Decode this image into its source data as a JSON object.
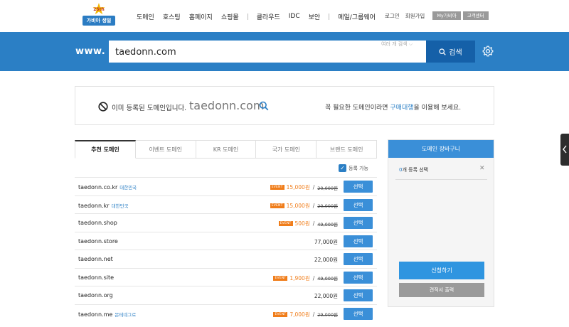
{
  "header": {
    "logo_badge": "25th",
    "logo_text": "가비아 생일",
    "nav": [
      "도메인",
      "호스팅",
      "홈페이지",
      "쇼핑몰",
      "클라우드",
      "IDC",
      "보안",
      "메일/그룹웨어"
    ],
    "util": {
      "login": "로그인",
      "signup": "회원가입",
      "my": "My가비아",
      "support": "고객센터"
    }
  },
  "search": {
    "prefix": "www.",
    "value": "taedonn.com",
    "multi_search": "여러 개 검색  ⌵",
    "button": "검색",
    "settings_icon": "gear-icon"
  },
  "notice": {
    "text": "이미 등록된 도메인입니다.",
    "domain": "taedonn.com",
    "right_pre": "꼭 필요한 도메인이라면 ",
    "right_link": "구매대행",
    "right_post": "을 이용해 보세요."
  },
  "tabs": [
    "추천 도메인",
    "이벤트 도메인",
    "KR 도메인",
    "국가 도메인",
    "브랜드 도메인"
  ],
  "active_tab": 0,
  "filter": {
    "label": "등록 가능",
    "checked": true
  },
  "select_label": "선택",
  "event_label": "EVENT",
  "domains": [
    {
      "name": "taedonn.co.kr",
      "region": "대한민국",
      "sale": "15,000원",
      "orig": "20,000원"
    },
    {
      "name": "taedonn.kr",
      "region": "대한민국",
      "sale": "15,000원",
      "orig": "20,000원"
    },
    {
      "name": "taedonn.shop",
      "region": "",
      "sale": "500원",
      "orig": "49,000원"
    },
    {
      "name": "taedonn.store",
      "region": "",
      "price": "77,000원"
    },
    {
      "name": "taedonn.net",
      "region": "",
      "price": "22,000원"
    },
    {
      "name": "taedonn.site",
      "region": "",
      "sale": "1,900원",
      "orig": "49,000원"
    },
    {
      "name": "taedonn.org",
      "region": "",
      "price": "22,000원"
    },
    {
      "name": "taedonn.me",
      "region": "몬테네그로",
      "sale": "7,000원",
      "orig": "29,000원"
    }
  ],
  "cart": {
    "title": "도메인 장바구니",
    "count": "0",
    "count_suffix": "개 등록 선택",
    "apply": "신청하기",
    "quote": "견적서 출력"
  },
  "colors": {
    "brand_blue": "#2b7fc5",
    "search_btn": "#1560a8",
    "event_orange": "#f07d1a"
  }
}
